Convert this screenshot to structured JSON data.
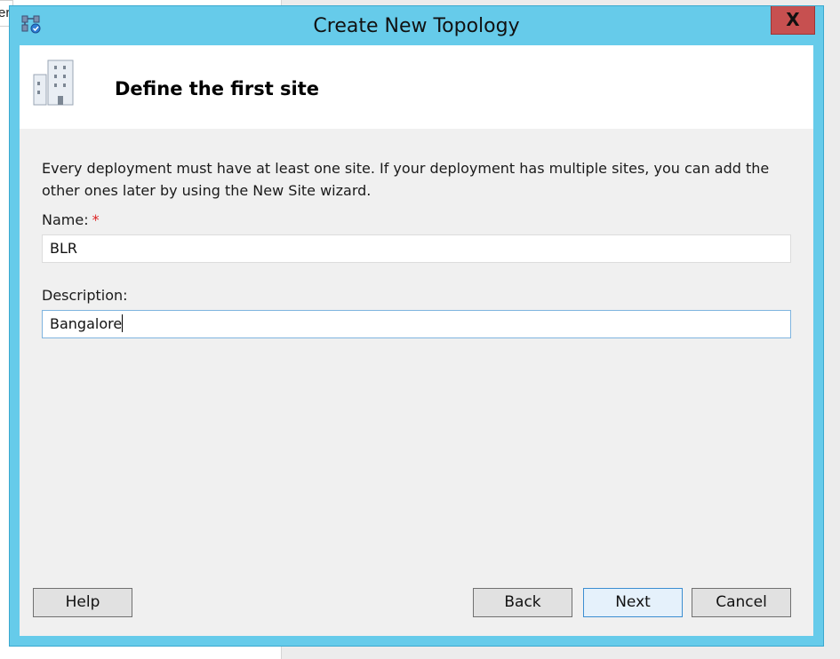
{
  "background": {
    "tab_text": "er"
  },
  "dialog": {
    "title": "Create New Topology",
    "close_label": "X"
  },
  "header": {
    "title": "Define the first site"
  },
  "intro_text": "Every deployment must have at least one site. If your deployment has multiple sites, you can add the other ones later by using the New Site wizard.",
  "form": {
    "name_label": "Name:",
    "required_marker": "*",
    "name_value": "BLR",
    "description_label": "Description:",
    "description_value": "Bangalore"
  },
  "buttons": {
    "help": "Help",
    "back": "Back",
    "next": "Next",
    "cancel": "Cancel"
  },
  "colors": {
    "title_bar": "#66cbea",
    "close_button": "#c75050",
    "required_marker": "#dd2222",
    "primary_button_border": "#3c8ed1"
  },
  "icons": {
    "app": "topology-app-icon",
    "site": "building-icon"
  }
}
